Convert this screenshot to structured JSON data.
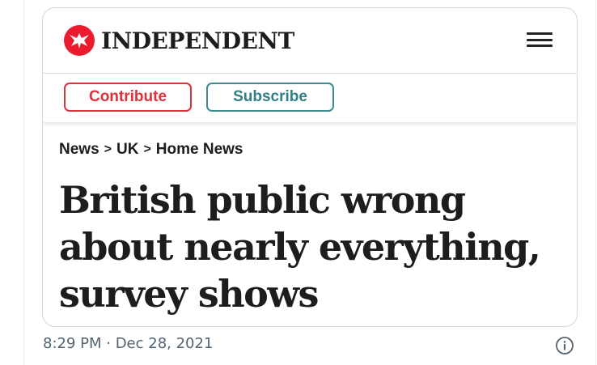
{
  "card": {
    "brand": {
      "name": "INDEPENDENT",
      "logo_icon": "eagle-icon",
      "logo_color": "#ec1a2e"
    },
    "menu_icon": "hamburger-menu-icon",
    "actions": {
      "contribute_label": "Contribute",
      "subscribe_label": "Subscribe",
      "contribute_color": "#e0303a",
      "subscribe_color": "#2f7f86"
    },
    "breadcrumb": {
      "items": [
        "News",
        "UK",
        "Home News"
      ],
      "separator": ">"
    },
    "headline": "British public wrong about nearly everything, survey shows"
  },
  "tweet": {
    "timestamp": "8:29 PM · Dec 28, 2021",
    "info_icon": "info-icon"
  }
}
